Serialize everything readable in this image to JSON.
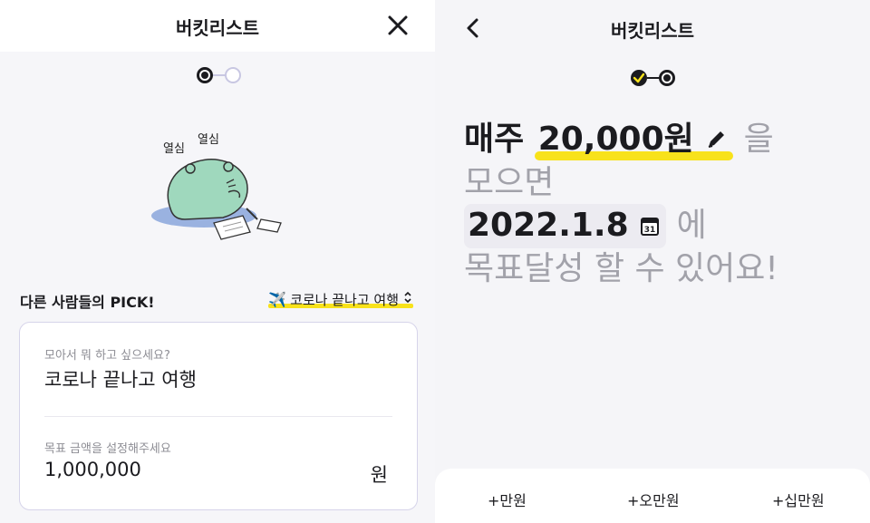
{
  "left": {
    "title": "버킷리스트",
    "close_icon": "close-icon",
    "steps": {
      "total": 2,
      "current": 1
    },
    "illustration": {
      "text_left": "열심",
      "text_right": "열심",
      "icon": "frog-character-working-icon"
    },
    "pick": {
      "label": "다른 사람들의 PICK!",
      "selected_icon": "✈️",
      "selected": "코로나 끝나고 여행"
    },
    "form": {
      "goal_label": "모아서 뭐 하고 싶으세요?",
      "goal_value": "코로나 끝나고 여행",
      "amount_label": "목표 금액을 설정해주세요",
      "amount_value": "1,000,000",
      "unit": "원"
    }
  },
  "right": {
    "title": "버킷리스트",
    "back_icon": "chevron-left-icon",
    "steps": {
      "total": 2,
      "current": 2
    },
    "line1_prefix": "매주",
    "amount": "20,000원",
    "line1_suffix": "을",
    "line2": "모으면",
    "date": "2022.1.8",
    "line3_suffix": "에",
    "line4": "목표달성 할 수 있어요!",
    "calendar_day": "31",
    "quick_add": [
      "+만원",
      "+오만원",
      "+십만원"
    ]
  },
  "colors": {
    "accent_yellow": "#f8e21b",
    "text_dark": "#1b1b1f",
    "text_dim": "#a2a2aa",
    "border": "#d6d4ea",
    "step_active": "#1b1b1f",
    "step_inactive": "#c8c7e2"
  }
}
